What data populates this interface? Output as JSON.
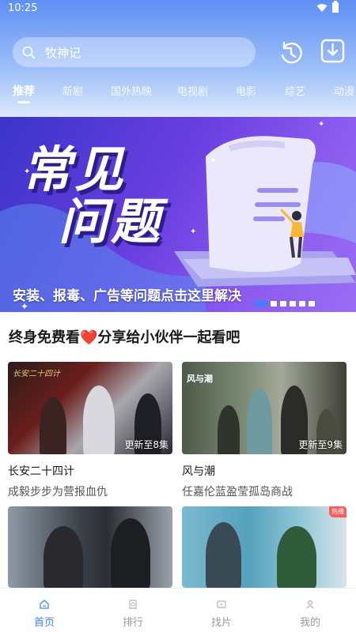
{
  "status_bar": {
    "time": "10:25"
  },
  "search": {
    "text": "牧神记"
  },
  "tabs": [
    {
      "label": "推荐",
      "active": true
    },
    {
      "label": "新剧"
    },
    {
      "label": "国外热映"
    },
    {
      "label": "电视剧"
    },
    {
      "label": "电影"
    },
    {
      "label": "综艺"
    },
    {
      "label": "动漫"
    }
  ],
  "banner": {
    "headline_line1": "常见",
    "headline_line2": "问题",
    "caption": "安装、报毒、广告等问题点击这里解决",
    "page_count": 6,
    "current_page": 1
  },
  "section": {
    "title_before": "终身免费看",
    "heart": "❤️",
    "title_after": "分享给小伙伴一起看吧"
  },
  "cards": [
    {
      "title": "长安二十四计",
      "desc": "成毅步步为营报血仇",
      "badge": "更新至8集",
      "poster_text": "长安二十四计"
    },
    {
      "title": "风与潮",
      "desc": "任嘉伦蓝盈莹孤岛商战",
      "badge": "更新至9集",
      "poster_text": "风与潮"
    },
    {
      "title": "",
      "desc": "",
      "badge": ""
    },
    {
      "title": "",
      "desc": "",
      "badge": "",
      "tag": "热播"
    }
  ],
  "bottom_nav": [
    {
      "label": "首页",
      "icon": "home-icon",
      "active": true
    },
    {
      "label": "排行",
      "icon": "ranking-icon"
    },
    {
      "label": "找片",
      "icon": "find-film-icon"
    },
    {
      "label": "我的",
      "icon": "profile-icon"
    }
  ],
  "colors": {
    "accent": "#3d84f7",
    "header_top": "#5f8ff5",
    "banner": "#6a3fe0"
  }
}
